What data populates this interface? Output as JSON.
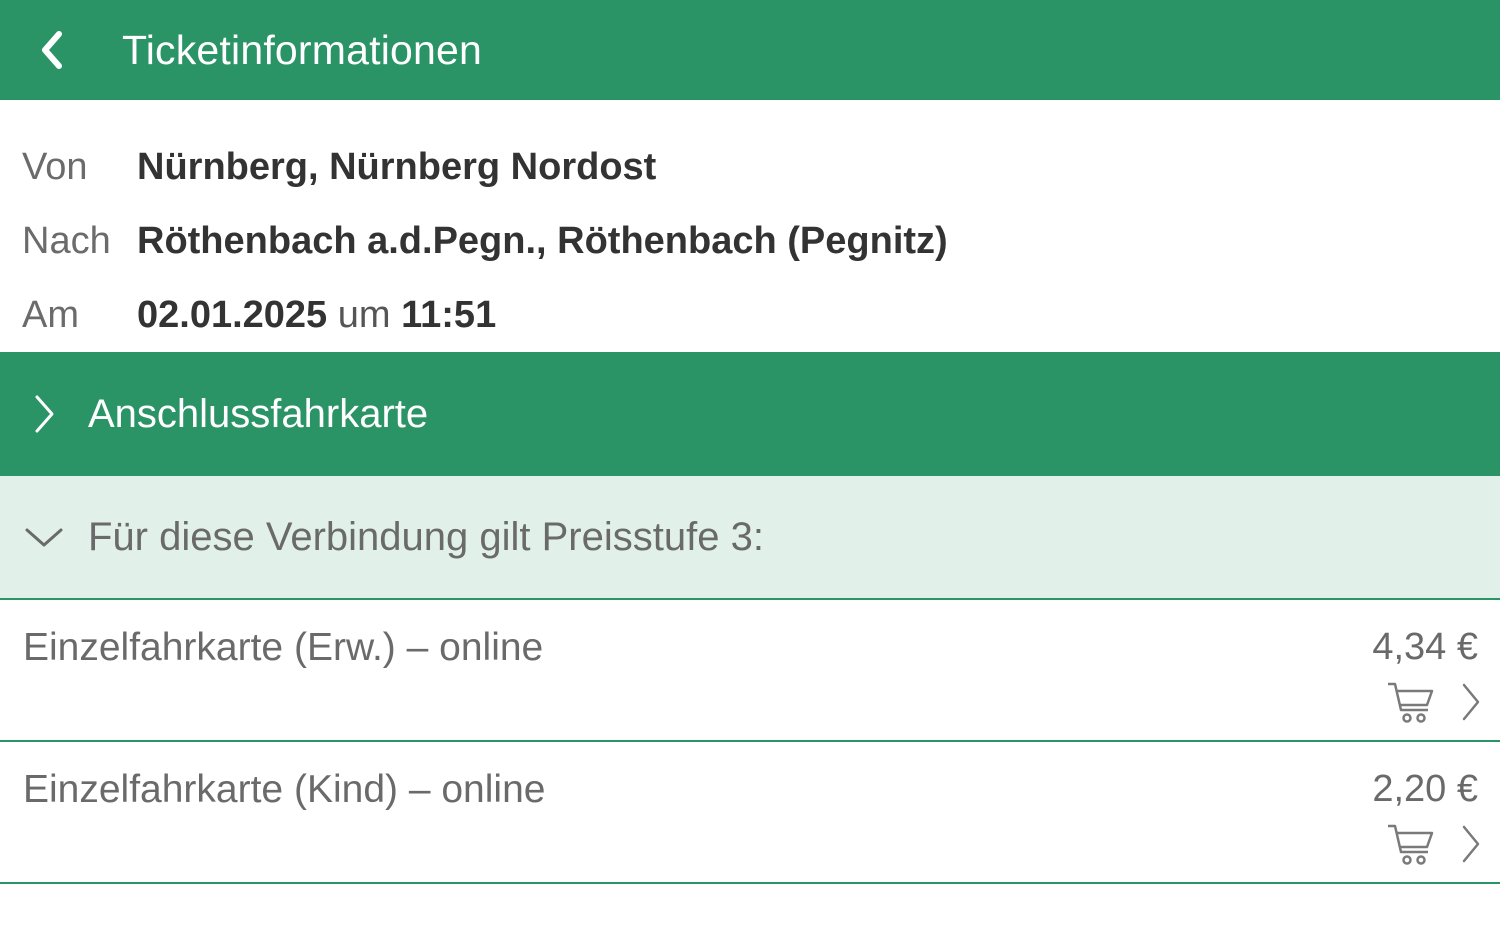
{
  "header": {
    "title": "Ticketinformationen",
    "back_icon": "chevron-left-icon"
  },
  "trip": {
    "from_label": "Von",
    "from_value": "Nürnberg, Nürnberg Nordost",
    "to_label": "Nach",
    "to_value": "Röthenbach a.d.Pegn., Röthenbach (Pegnitz)",
    "date_label": "Am",
    "date_value": "02.01.2025",
    "time_connector": "um",
    "time_value": "11:51"
  },
  "sections": {
    "connection_ticket_label": "Anschlussfahrkarte",
    "price_tier_label": "Für diese Verbindung gilt Preisstufe 3:"
  },
  "tickets": [
    {
      "name": "Einzelfahrkarte (Erw.) – online",
      "price": "4,34 €"
    },
    {
      "name": "Einzelfahrkarte (Kind) – online",
      "price": "2,20 €"
    }
  ],
  "colors": {
    "primary": "#2b9467",
    "tier_background": "#e1f1ea",
    "muted_text": "#6a6a6a"
  }
}
